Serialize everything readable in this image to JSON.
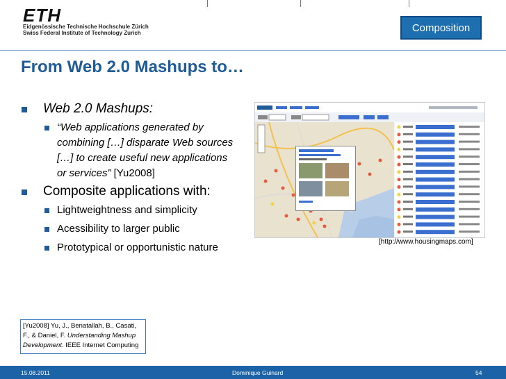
{
  "header": {
    "logo_mark": "ETH",
    "logo_line1": "Eidgenössische Technische Hochschule Zürich",
    "logo_line2": "Swiss Federal Institute of Technology Zurich",
    "badge": "Composition"
  },
  "slide": {
    "title": "From Web 2.0 Mashups to…",
    "bullets": [
      {
        "label": "Web 2.0 Mashups:"
      },
      {
        "label": "Composite applications with:"
      }
    ],
    "quote_lines": [
      "“Web applications generated by",
      "combining […] disparate Web sources",
      "[…] to create useful new applications",
      "or services”"
    ],
    "quote_ref": " [Yu2008]",
    "sub_bullets": [
      "Lightweightness and simplicity",
      "Acessibility to larger public",
      "Prototypical or opportunistic nature"
    ],
    "caption": "[http://www.housingmaps.com]",
    "reference": {
      "line1": "[Yu2008] Yu, J., Benatallah, B., Casati,",
      "line2": "F., & Daniel, F. ",
      "title_italic": "Understanding Mashup",
      "line3_italic": "Development",
      "line3_rest": ". IEEE Internet Computing"
    }
  },
  "footer": {
    "date": "15.08.2011",
    "author": "Dominique Guinard",
    "page": "54"
  },
  "colors": {
    "accent": "#1f5c97",
    "footer": "#1b63a6",
    "badge": "#1e6fb0"
  }
}
